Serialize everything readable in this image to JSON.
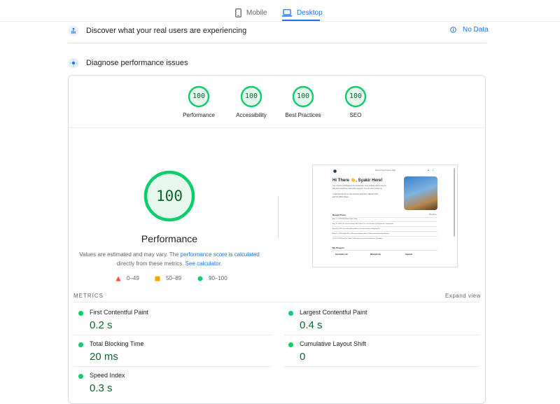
{
  "tabs": [
    {
      "label": "Mobile",
      "icon": "phone-icon",
      "active": false
    },
    {
      "label": "Desktop",
      "icon": "laptop-icon",
      "active": true
    }
  ],
  "field_section": {
    "title": "Discover what your real users are experiencing",
    "status": "No Data"
  },
  "lab_section": {
    "title": "Diagnose performance issues"
  },
  "categories": [
    {
      "label": "Performance",
      "score": "100"
    },
    {
      "label": "Accessibility",
      "score": "100"
    },
    {
      "label": "Best Practices",
      "score": "100"
    },
    {
      "label": "SEO",
      "score": "100"
    }
  ],
  "focus": {
    "score": "100",
    "title": "Performance",
    "disclaimer_pre": "Values are estimated and may vary. The ",
    "disclaimer_link1": "performance score is calculated",
    "disclaimer_mid": " directly from these metrics. ",
    "disclaimer_link2": "See calculator",
    "disclaimer_post": "."
  },
  "legend": [
    {
      "label": "0–49",
      "shape": "triangle",
      "color": "#ff4e42"
    },
    {
      "label": "50–89",
      "shape": "square",
      "color": "#ffa400"
    },
    {
      "label": "90–100",
      "shape": "circle",
      "color": "#0cce6b"
    }
  ],
  "colors": {
    "accent": "#1a73e8",
    "pass": "#0cce6b",
    "pass_text": "#0d652d"
  },
  "thumbnail": {
    "nav": "Home  Posts  Projects  Tags",
    "hero": "Hi There 👋, Syakir Here!",
    "intro1": "I am a Front-end Engineer from Indonesia. I love sharing what I know on",
    "intro2": "blog and sometimes I also share projects. You can also contact me",
    "intro3": "I made this site for my own learning, with Astro, Tailwind CSS,",
    "intro4": "and Cloudflare Pages.",
    "recent_posts": "Recent Posts",
    "view_all": "All posts »",
    "posts": [
      "Aug 17, 2023   Markdown Style Guide",
      "Aug 10, 2023   The Post to Going With: When You Can Render Out Extension Components",
      "Aug 09, 2023   Learn about Astro Ahead, Schema Helpers Mapping Kit",
      "Aug 07, 2023   Nightly Pass Whatever Update: Mass Of Astro Keep Mistakes Engine",
      "Jul 28, 2023   First Post: How To Become a Successful Software Developer"
    ],
    "my_projects": "My Projects",
    "projects": [
      "Geosmiths.com",
      "Mahendi Cap",
      "Syaviuat"
    ]
  },
  "metrics": {
    "section_label": "METRICS",
    "expand_label": "Expand view",
    "items": [
      {
        "name": "First Contentful Paint",
        "value": "0.2 s"
      },
      {
        "name": "Largest Contentful Paint",
        "value": "0.4 s"
      },
      {
        "name": "Total Blocking Time",
        "value": "20 ms"
      },
      {
        "name": "Cumulative Layout Shift",
        "value": "0"
      },
      {
        "name": "Speed Index",
        "value": "0.3 s"
      }
    ]
  }
}
